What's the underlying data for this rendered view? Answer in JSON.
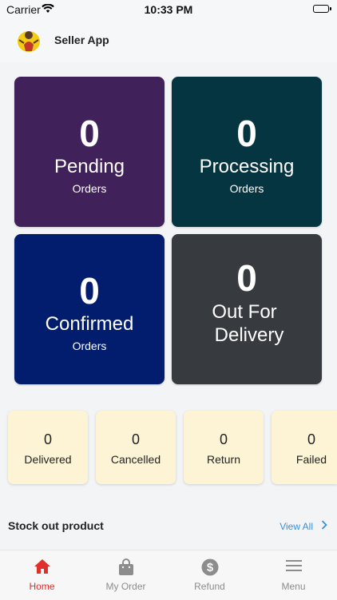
{
  "status_bar": {
    "carrier": "Carrier",
    "time": "10:33 PM"
  },
  "header": {
    "title": "Seller App"
  },
  "stats": {
    "pending": {
      "count": "0",
      "title": "Pending",
      "sub": "Orders",
      "color": "#41215a"
    },
    "processing": {
      "count": "0",
      "title": "Processing",
      "sub": "Orders",
      "color": "#063542"
    },
    "confirmed": {
      "count": "0",
      "title": "Confirmed",
      "sub": "Orders",
      "color": "#021d6d"
    },
    "out_for_delivery": {
      "count": "0",
      "title_line1": "Out For",
      "title_line2": "Delivery",
      "color": "#373a3e"
    }
  },
  "summary": [
    {
      "count": "0",
      "label": "Delivered"
    },
    {
      "count": "0",
      "label": "Cancelled"
    },
    {
      "count": "0",
      "label": "Return"
    },
    {
      "count": "0",
      "label": "Failed"
    }
  ],
  "section": {
    "title": "Stock out product",
    "view_all": "View All"
  },
  "nav": [
    {
      "label": "Home",
      "icon": "home-icon",
      "active": true
    },
    {
      "label": "My Order",
      "icon": "shopping-bag-icon"
    },
    {
      "label": "Refund",
      "icon": "dollar-icon"
    },
    {
      "label": "Menu",
      "icon": "hamburger-menu-icon"
    }
  ],
  "colors": {
    "accent": "#e0302b",
    "link": "#3b8ed8",
    "tile_bg": "#fdf4d6"
  }
}
